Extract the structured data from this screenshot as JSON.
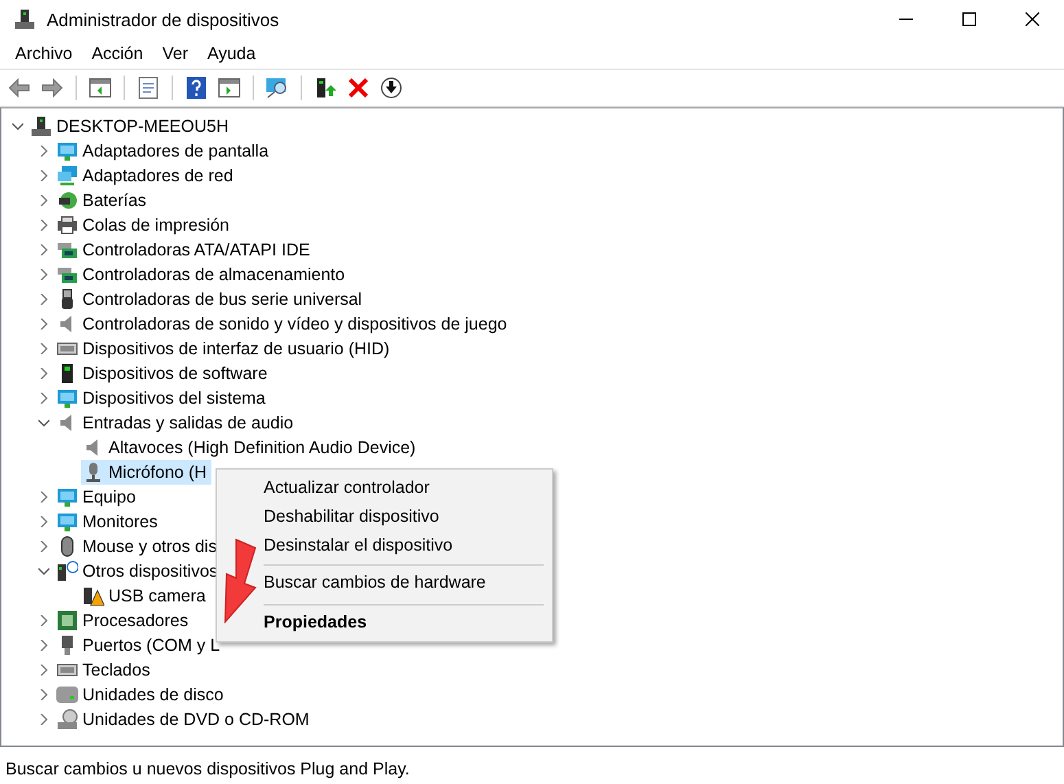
{
  "window": {
    "title": "Administrador de dispositivos"
  },
  "menu": [
    "Archivo",
    "Acción",
    "Ver",
    "Ayuda"
  ],
  "tree": [
    {
      "label": "DESKTOP-MEEOU5H",
      "kind": "computer",
      "expanded": true,
      "selected": false,
      "children": [
        {
          "label": "Adaptadores de pantalla",
          "kind": "display",
          "expanded": false,
          "selected": false
        },
        {
          "label": "Adaptadores de red",
          "kind": "network",
          "expanded": false,
          "selected": false
        },
        {
          "label": "Baterías",
          "kind": "battery",
          "expanded": false,
          "selected": false
        },
        {
          "label": "Colas de impresión",
          "kind": "printer",
          "expanded": false,
          "selected": false
        },
        {
          "label": "Controladoras ATA/ATAPI IDE",
          "kind": "card",
          "expanded": false,
          "selected": false
        },
        {
          "label": "Controladoras de almacenamiento",
          "kind": "card",
          "expanded": false,
          "selected": false
        },
        {
          "label": "Controladoras de bus serie universal",
          "kind": "usb",
          "expanded": false,
          "selected": false
        },
        {
          "label": "Controladoras de sonido y vídeo y dispositivos de juego",
          "kind": "speaker",
          "expanded": false,
          "selected": false
        },
        {
          "label": "Dispositivos de interfaz de usuario (HID)",
          "kind": "keyboard",
          "expanded": false,
          "selected": false
        },
        {
          "label": "Dispositivos de software",
          "kind": "tower",
          "expanded": false,
          "selected": false
        },
        {
          "label": "Dispositivos del sistema",
          "kind": "display",
          "expanded": false,
          "selected": false
        },
        {
          "label": "Entradas y salidas de audio",
          "kind": "speaker",
          "expanded": true,
          "selected": false,
          "children": [
            {
              "label": "Altavoces (High Definition Audio Device)",
              "kind": "speaker",
              "selected": false
            },
            {
              "label": "Micrófono (H",
              "kind": "mic",
              "selected": true
            }
          ]
        },
        {
          "label": "Equipo",
          "kind": "display",
          "expanded": false,
          "selected": false
        },
        {
          "label": "Monitores",
          "kind": "display",
          "expanded": false,
          "selected": false
        },
        {
          "label": "Mouse y otros dis",
          "kind": "mouse",
          "expanded": false,
          "selected": false
        },
        {
          "label": "Otros dispositivos",
          "kind": "unknown",
          "expanded": true,
          "selected": false,
          "children": [
            {
              "label": "USB camera",
              "kind": "warning",
              "selected": false
            }
          ]
        },
        {
          "label": "Procesadores",
          "kind": "chip",
          "expanded": false,
          "selected": false
        },
        {
          "label": "Puertos (COM y L",
          "kind": "port",
          "expanded": false,
          "selected": false
        },
        {
          "label": "Teclados",
          "kind": "keyboard",
          "expanded": false,
          "selected": false
        },
        {
          "label": "Unidades de disco",
          "kind": "disk",
          "expanded": false,
          "selected": false
        },
        {
          "label": "Unidades de DVD o CD-ROM",
          "kind": "dvd",
          "expanded": false,
          "selected": false
        }
      ]
    }
  ],
  "context_menu": [
    {
      "label": "Actualizar controlador",
      "default": false,
      "separator_before": false
    },
    {
      "label": "Deshabilitar dispositivo",
      "default": false,
      "separator_before": false
    },
    {
      "label": "Desinstalar el dispositivo",
      "default": false,
      "separator_before": false
    },
    {
      "label": "Buscar cambios de hardware",
      "default": false,
      "separator_before": true
    },
    {
      "label": "Propiedades",
      "default": true,
      "separator_before": true
    }
  ],
  "status_bar": "Buscar cambios u nuevos dispositivos Plug and Play."
}
